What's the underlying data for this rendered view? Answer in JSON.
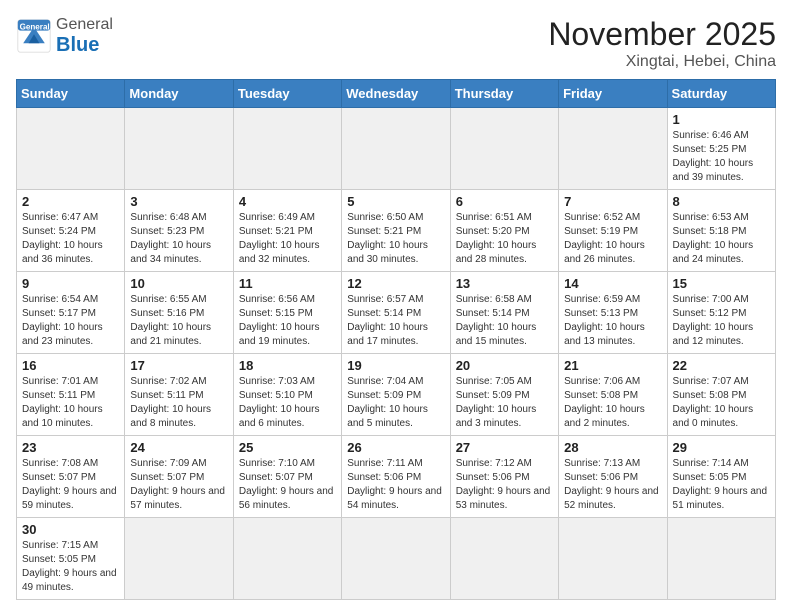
{
  "header": {
    "logo_general": "General",
    "logo_blue": "Blue",
    "title": "November 2025",
    "subtitle": "Xingtai, Hebei, China"
  },
  "days_of_week": [
    "Sunday",
    "Monday",
    "Tuesday",
    "Wednesday",
    "Thursday",
    "Friday",
    "Saturday"
  ],
  "weeks": [
    [
      {
        "day": "",
        "info": ""
      },
      {
        "day": "",
        "info": ""
      },
      {
        "day": "",
        "info": ""
      },
      {
        "day": "",
        "info": ""
      },
      {
        "day": "",
        "info": ""
      },
      {
        "day": "",
        "info": ""
      },
      {
        "day": "1",
        "info": "Sunrise: 6:46 AM\nSunset: 5:25 PM\nDaylight: 10 hours and 39 minutes."
      }
    ],
    [
      {
        "day": "2",
        "info": "Sunrise: 6:47 AM\nSunset: 5:24 PM\nDaylight: 10 hours and 36 minutes."
      },
      {
        "day": "3",
        "info": "Sunrise: 6:48 AM\nSunset: 5:23 PM\nDaylight: 10 hours and 34 minutes."
      },
      {
        "day": "4",
        "info": "Sunrise: 6:49 AM\nSunset: 5:21 PM\nDaylight: 10 hours and 32 minutes."
      },
      {
        "day": "5",
        "info": "Sunrise: 6:50 AM\nSunset: 5:21 PM\nDaylight: 10 hours and 30 minutes."
      },
      {
        "day": "6",
        "info": "Sunrise: 6:51 AM\nSunset: 5:20 PM\nDaylight: 10 hours and 28 minutes."
      },
      {
        "day": "7",
        "info": "Sunrise: 6:52 AM\nSunset: 5:19 PM\nDaylight: 10 hours and 26 minutes."
      },
      {
        "day": "8",
        "info": "Sunrise: 6:53 AM\nSunset: 5:18 PM\nDaylight: 10 hours and 24 minutes."
      }
    ],
    [
      {
        "day": "9",
        "info": "Sunrise: 6:54 AM\nSunset: 5:17 PM\nDaylight: 10 hours and 23 minutes."
      },
      {
        "day": "10",
        "info": "Sunrise: 6:55 AM\nSunset: 5:16 PM\nDaylight: 10 hours and 21 minutes."
      },
      {
        "day": "11",
        "info": "Sunrise: 6:56 AM\nSunset: 5:15 PM\nDaylight: 10 hours and 19 minutes."
      },
      {
        "day": "12",
        "info": "Sunrise: 6:57 AM\nSunset: 5:14 PM\nDaylight: 10 hours and 17 minutes."
      },
      {
        "day": "13",
        "info": "Sunrise: 6:58 AM\nSunset: 5:14 PM\nDaylight: 10 hours and 15 minutes."
      },
      {
        "day": "14",
        "info": "Sunrise: 6:59 AM\nSunset: 5:13 PM\nDaylight: 10 hours and 13 minutes."
      },
      {
        "day": "15",
        "info": "Sunrise: 7:00 AM\nSunset: 5:12 PM\nDaylight: 10 hours and 12 minutes."
      }
    ],
    [
      {
        "day": "16",
        "info": "Sunrise: 7:01 AM\nSunset: 5:11 PM\nDaylight: 10 hours and 10 minutes."
      },
      {
        "day": "17",
        "info": "Sunrise: 7:02 AM\nSunset: 5:11 PM\nDaylight: 10 hours and 8 minutes."
      },
      {
        "day": "18",
        "info": "Sunrise: 7:03 AM\nSunset: 5:10 PM\nDaylight: 10 hours and 6 minutes."
      },
      {
        "day": "19",
        "info": "Sunrise: 7:04 AM\nSunset: 5:09 PM\nDaylight: 10 hours and 5 minutes."
      },
      {
        "day": "20",
        "info": "Sunrise: 7:05 AM\nSunset: 5:09 PM\nDaylight: 10 hours and 3 minutes."
      },
      {
        "day": "21",
        "info": "Sunrise: 7:06 AM\nSunset: 5:08 PM\nDaylight: 10 hours and 2 minutes."
      },
      {
        "day": "22",
        "info": "Sunrise: 7:07 AM\nSunset: 5:08 PM\nDaylight: 10 hours and 0 minutes."
      }
    ],
    [
      {
        "day": "23",
        "info": "Sunrise: 7:08 AM\nSunset: 5:07 PM\nDaylight: 9 hours and 59 minutes."
      },
      {
        "day": "24",
        "info": "Sunrise: 7:09 AM\nSunset: 5:07 PM\nDaylight: 9 hours and 57 minutes."
      },
      {
        "day": "25",
        "info": "Sunrise: 7:10 AM\nSunset: 5:07 PM\nDaylight: 9 hours and 56 minutes."
      },
      {
        "day": "26",
        "info": "Sunrise: 7:11 AM\nSunset: 5:06 PM\nDaylight: 9 hours and 54 minutes."
      },
      {
        "day": "27",
        "info": "Sunrise: 7:12 AM\nSunset: 5:06 PM\nDaylight: 9 hours and 53 minutes."
      },
      {
        "day": "28",
        "info": "Sunrise: 7:13 AM\nSunset: 5:06 PM\nDaylight: 9 hours and 52 minutes."
      },
      {
        "day": "29",
        "info": "Sunrise: 7:14 AM\nSunset: 5:05 PM\nDaylight: 9 hours and 51 minutes."
      }
    ],
    [
      {
        "day": "30",
        "info": "Sunrise: 7:15 AM\nSunset: 5:05 PM\nDaylight: 9 hours and 49 minutes."
      },
      {
        "day": "",
        "info": ""
      },
      {
        "day": "",
        "info": ""
      },
      {
        "day": "",
        "info": ""
      },
      {
        "day": "",
        "info": ""
      },
      {
        "day": "",
        "info": ""
      },
      {
        "day": "",
        "info": ""
      }
    ]
  ]
}
